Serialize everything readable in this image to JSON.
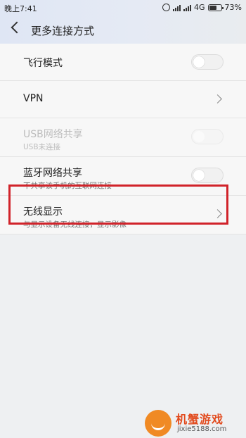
{
  "status_bar": {
    "time": "晚上7:41",
    "network": "4G",
    "battery": "73%",
    "battery_level": 0.73
  },
  "header": {
    "title": "更多连接方式"
  },
  "settings": [
    {
      "label": "飞行模式",
      "subtitle": "",
      "control": "toggle",
      "enabled": true,
      "on": false
    },
    {
      "label": "VPN",
      "subtitle": "",
      "control": "chevron",
      "enabled": true
    },
    {
      "label": "USB网络共享",
      "subtitle": "USB未连接",
      "control": "toggle",
      "enabled": false,
      "on": false
    },
    {
      "label": "蓝牙网络共享",
      "subtitle": "不共享该手机的互联网连接",
      "control": "toggle",
      "enabled": true,
      "on": false
    },
    {
      "label": "无线显示",
      "subtitle": "与显示设备无线连接，显示影像",
      "control": "chevron",
      "enabled": true
    }
  ],
  "colors": {
    "highlight": "#d1232a",
    "accent": "#f08a24"
  },
  "watermark": {
    "name": "机蟹游戏",
    "url": "jixie5188.com"
  }
}
